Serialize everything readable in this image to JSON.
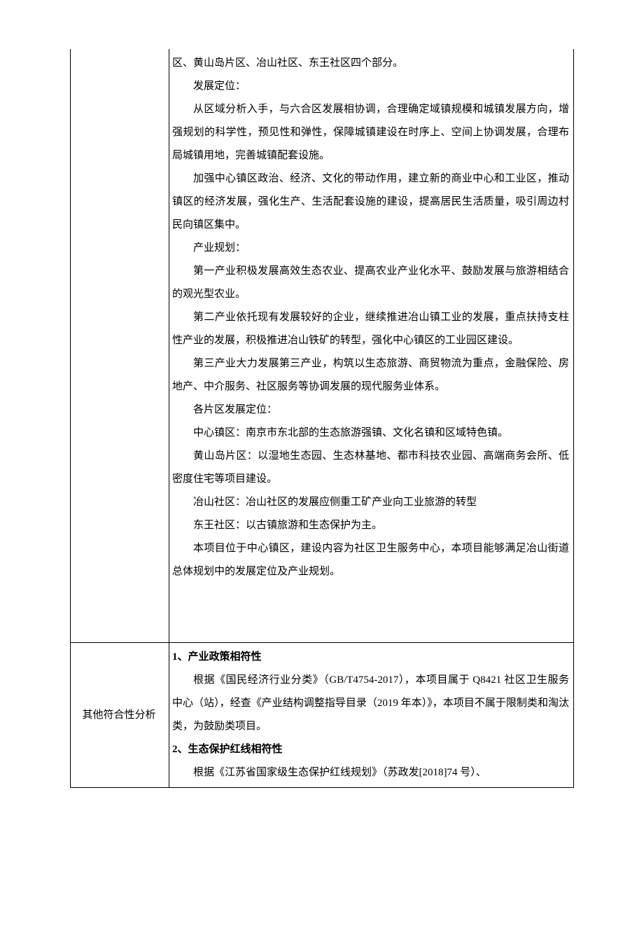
{
  "row1": {
    "label": "",
    "p1": "区、黄山岛片区、冶山社区、东王社区四个部分。",
    "h1": "发展定位：",
    "p2": "从区域分析入手，与六合区发展相协调，合理确定域镇规模和城镇发展方向，增强规划的科学性，预见性和弹性，保障城镇建设在时序上、空间上协调发展，合理布局城镇用地，完善城镇配套设施。",
    "p3": "加强中心镇区政治、经济、文化的带动作用，建立新的商业中心和工业区，推动镇区的经济发展，强化生产、生活配套设施的建设，提高居民生活质量，吸引周边村民向镇区集中。",
    "h2": "产业规划：",
    "p4": "第一产业积极发展高效生态农业、提高农业产业化水平、鼓励发展与旅游相结合的观光型农业。",
    "p5": "第二产业依托现有发展较好的企业，继续推进冶山镇工业的发展，重点扶持支柱性产业的发展，积极推进冶山铁矿的转型，强化中心镇区的工业园区建设。",
    "p6": "第三产业大力发展第三产业，构筑以生态旅游、商贸物流为重点，金融保险、房地产、中介服务、社区服务等协调发展的现代服务业体系。",
    "h3": "各片区发展定位：",
    "p7": "中心镇区：南京市东北部的生态旅游强镇、文化名镇和区域特色镇。",
    "p8": "黄山岛片区：以湿地生态园、生态林基地、都市科技农业园、高端商务会所、低密度住宅等项目建设。",
    "p9": "冶山社区：冶山社区的发展应侧重工矿产业向工业旅游的转型",
    "p10": "东王社区：以古镇旅游和生态保护为主。",
    "p11": "本项目位于中心镇区，建设内容为社区卫生服务中心，本项目能够满足冶山街道总体规划中的发展定位及产业规划。"
  },
  "row2": {
    "label": "其他符合性分析",
    "h1": "1、产业政策相符性",
    "p1": "根据《国民经济行业分类》（GB/T4754-2017），本项目属于 Q8421 社区卫生服务中心（站），经查《产业结构调整指导目录（2019 年本）》，本项目不属于限制类和淘汰类，为鼓励类项目。",
    "h2": "2、生态保护红线相符性",
    "p2": "根据《江苏省国家级生态保护红线规划》（苏政发[2018]74 号）、"
  }
}
